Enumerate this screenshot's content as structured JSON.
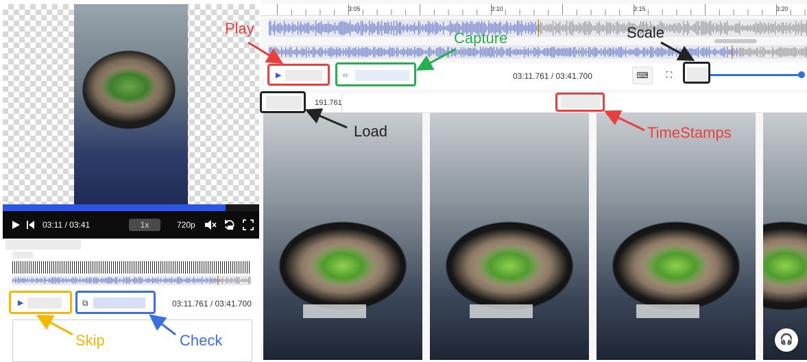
{
  "player": {
    "time": "03:11 / 03:41",
    "speed": "1x",
    "quality": "720p",
    "progress_fraction": 0.87
  },
  "left_panel": {
    "time_display": "03:11.761 / 03:41.700"
  },
  "right_panel": {
    "ruler_ticks": [
      "3:05",
      "3:10",
      "3:15",
      "3:20"
    ],
    "time_display": "03:11.761 / 03:41.700",
    "load_value": "191.761"
  },
  "annotations": {
    "play": "Play",
    "capture": "Capture",
    "scale": "Scale",
    "load": "Load",
    "timestamps": "TimeStamps",
    "skip": "Skip",
    "check": "Check"
  },
  "colors": {
    "red": "#e8403c",
    "green": "#22b14c",
    "black": "#222222",
    "yellow": "#f5b800",
    "blue": "#3a6fe0",
    "accent": "#2f55e6"
  }
}
